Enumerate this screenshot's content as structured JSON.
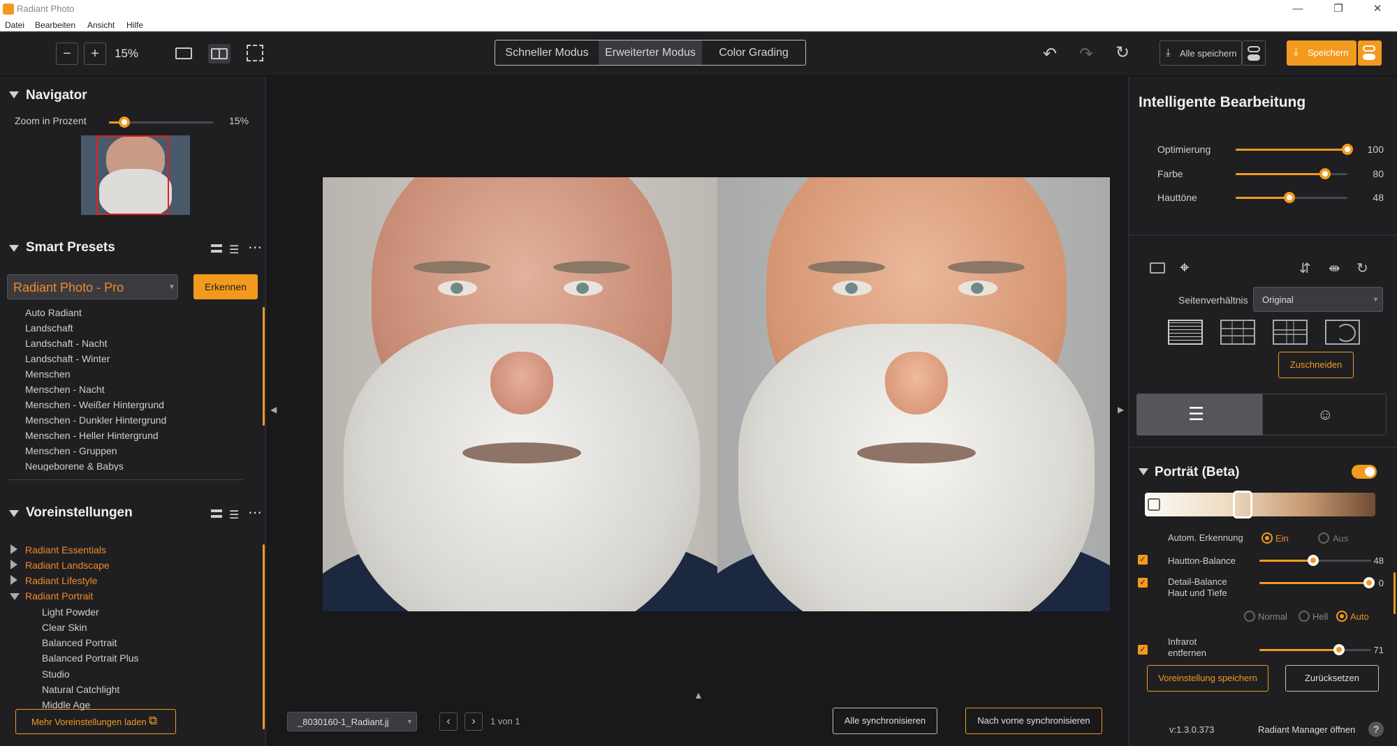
{
  "app": {
    "title": "Radiant Photo"
  },
  "menu": [
    "Datei",
    "Bearbeiten",
    "Ansicht",
    "Hilfe"
  ],
  "toolbar": {
    "zoom": "15%",
    "modes": [
      "Schneller Modus",
      "Erweiterter Modus",
      "Color Grading"
    ],
    "active_mode": "Erweiterter Modus",
    "save_all": "Alle speichern",
    "save": "Speichern"
  },
  "navigator": {
    "title": "Navigator",
    "zoom_label": "Zoom in Prozent",
    "zoom_value": "15%",
    "zoom_fraction": 0.15
  },
  "smart_presets": {
    "title": "Smart Presets",
    "selected": "Radiant Photo - Pro",
    "detect_button": "Erkennen",
    "items": [
      "Auto Radiant",
      "Landschaft",
      "Landschaft - Nacht",
      "Landschaft - Winter",
      "Menschen",
      "Menschen - Nacht",
      "Menschen - Weißer Hintergrund",
      "Menschen - Dunkler Hintergrund",
      "Menschen - Heller Hintergrund",
      "Menschen - Gruppen",
      "Neugeborene & Babys"
    ]
  },
  "presets": {
    "title": "Voreinstellungen",
    "groups": [
      "Radiant Essentials",
      "Radiant Landscape",
      "Radiant Lifestyle",
      "Radiant Portrait"
    ],
    "portrait_items": [
      "Light Powder",
      "Clear Skin",
      "Balanced Portrait",
      "Balanced Portrait Plus",
      "Studio",
      "Natural Catchlight",
      "Middle Age"
    ],
    "load_more": "Mehr Voreinstellungen laden"
  },
  "bottom": {
    "filename": "_8030160-1_Radiant.jj",
    "page": "1 von 1",
    "sync_all": "Alle synchronisieren",
    "sync_forward": "Nach vorne synchronisieren"
  },
  "smart_edit": {
    "title": "Intelligente Bearbeitung",
    "sliders": [
      {
        "label": "Optimierung",
        "value": 100
      },
      {
        "label": "Farbe",
        "value": 80
      },
      {
        "label": "Hauttöne",
        "value": 48
      }
    ]
  },
  "crop": {
    "ratio_label": "Seitenverhältnis",
    "ratio_value": "Original",
    "crop_button": "Zuschneiden"
  },
  "portrait": {
    "title": "Porträt (Beta)",
    "auto_detect_label": "Autom. Erkennung",
    "on_label": "Ein",
    "off_label": "Aus",
    "hauttone_label": "Hautton-Balance",
    "hauttone_value": "48",
    "hauttone_fraction": 0.48,
    "detail_label_1": "Detail-Balance",
    "detail_label_2": "Haut und Tiefe",
    "detail_value": "0",
    "detail_fraction": 0.98,
    "mode_normal": "Normal",
    "mode_hell": "Hell",
    "mode_auto": "Auto",
    "infrarot_label_1": "Infrarot",
    "infrarot_label_2": "entfernen",
    "infrarot_value": "71",
    "infrarot_fraction": 0.71,
    "save_preset": "Voreinstellung speichern",
    "reset": "Zurücksetzen"
  },
  "footer": {
    "version": "v:1.3.0.373",
    "manager": "Radiant Manager öffnen",
    "help": "?"
  },
  "colors": {
    "accent": "#f39a1e",
    "panel": "#1f1f22",
    "canvas": "#19191b"
  }
}
